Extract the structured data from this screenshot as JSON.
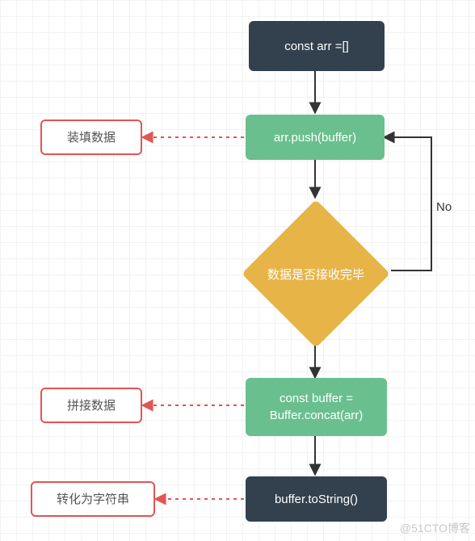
{
  "chart_data": {
    "type": "flowchart",
    "nodes": [
      {
        "id": "n1",
        "shape": "process-dark",
        "label": "const arr =[]"
      },
      {
        "id": "n2",
        "shape": "process-green",
        "label": "arr.push(buffer)"
      },
      {
        "id": "d1",
        "shape": "decision",
        "label": "数据是否接收完毕"
      },
      {
        "id": "n3",
        "shape": "process-green",
        "label": "const buffer =\nBuffer.concat(arr)"
      },
      {
        "id": "n4",
        "shape": "process-dark",
        "label": "buffer.toString()"
      }
    ],
    "annotations": [
      {
        "id": "a1",
        "target": "n2",
        "label": "装填数据"
      },
      {
        "id": "a2",
        "target": "n3",
        "label": "拼接数据"
      },
      {
        "id": "a3",
        "target": "n4",
        "label": "转化为字符串"
      }
    ],
    "edges": [
      {
        "from": "n1",
        "to": "n2",
        "label": ""
      },
      {
        "from": "n2",
        "to": "d1",
        "label": ""
      },
      {
        "from": "d1",
        "to": "n2",
        "label": "No",
        "kind": "loop-back"
      },
      {
        "from": "d1",
        "to": "n3",
        "label": ""
      },
      {
        "from": "n3",
        "to": "n4",
        "label": ""
      }
    ],
    "watermark": "@51CTO博客"
  },
  "nodes": {
    "n1": "const arr =[]",
    "n2": "arr.push(buffer)",
    "d1": "数据是否接收完毕",
    "n3_line1": "const buffer =",
    "n3_line2": "Buffer.concat(arr)",
    "n4": "buffer.toString()"
  },
  "notes": {
    "a1": "装填数据",
    "a2": "拼接数据",
    "a3": "转化为字符串"
  },
  "labels": {
    "no": "No"
  },
  "watermark": "@51CTO博客"
}
